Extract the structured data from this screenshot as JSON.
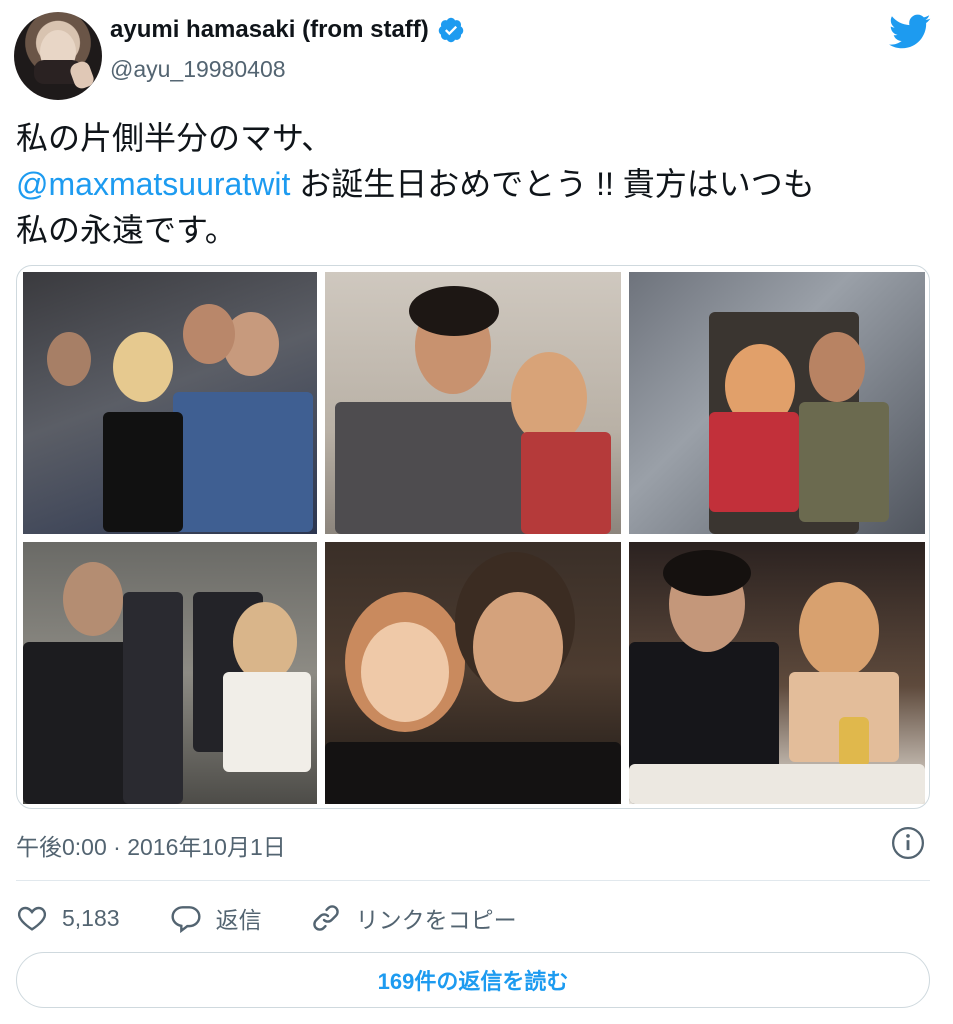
{
  "author": {
    "display_name": "ayumi hamasaki (from staff)",
    "handle": "@ayu_19980408",
    "verified": true
  },
  "tweet": {
    "text_line1": "私の片側半分のマサ、",
    "mention": "@maxmatsuuratwit",
    "text_line2_rest": " お誕生日おめでとう !! 貴方はいつも",
    "text_line3": "私の永遠です。",
    "photo_count": 6,
    "timestamp": "午後0:00 · 2016年10月1日"
  },
  "actions": {
    "likes": "5,183",
    "reply_label": "返信",
    "copy_link_label": "リンクをコピー"
  },
  "replies_button": "169件の返信を読む",
  "icons": {
    "brand": "twitter-bird-icon",
    "verified": "verified-badge-icon",
    "info": "info-icon",
    "like": "heart-icon",
    "reply": "speech-bubble-icon",
    "link": "link-icon"
  },
  "colors": {
    "accent": "#1d9bf0",
    "text_primary": "#0f1419",
    "text_secondary": "#536471",
    "border": "#cfd9de"
  }
}
